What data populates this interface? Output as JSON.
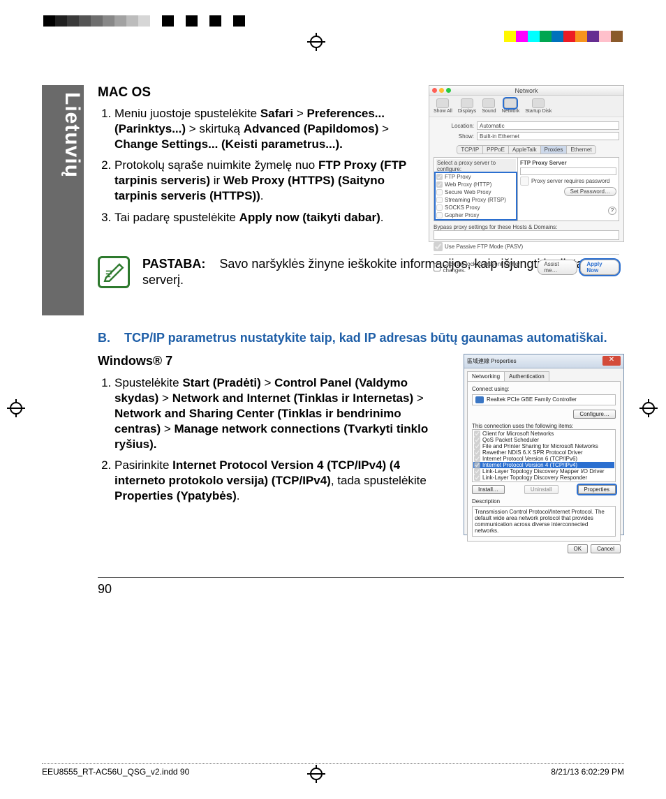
{
  "colorbar": {
    "left": [
      "#000000",
      "#202020",
      "#3a3a3a",
      "#545454",
      "#6e6e6e",
      "#888888",
      "#a2a2a2",
      "#bcbcbc",
      "#d6d6d6",
      "#ffffff",
      "#000000",
      "#ffffff",
      "#000000",
      "#ffffff",
      "#000000",
      "#ffffff",
      "#000000",
      "#ffffff"
    ],
    "right": [
      "#fff700",
      "#ff00ff",
      "#00ffff",
      "#00a651",
      "#0072bc",
      "#ed1c24",
      "#f7941d",
      "#662d91",
      "#ffc0cb",
      "#8b5a2b"
    ]
  },
  "langtab": "Lietuvių",
  "section1": {
    "title": "MAC OS",
    "items": [
      {
        "runs": [
          {
            "t": "Meniu juostoje spustelėkite "
          },
          {
            "t": "Safari",
            "b": true
          },
          {
            "t": " > "
          },
          {
            "t": "Preferences... (Parinktys...)",
            "b": true
          },
          {
            "t": " > skirtuką "
          },
          {
            "t": "Advanced (Papildomos)",
            "b": true
          },
          {
            "t": " > "
          },
          {
            "t": "Change Settings... (Keisti parametrus...).",
            "b": true
          }
        ]
      },
      {
        "runs": [
          {
            "t": "Protokolų sąraše nuimkite žymelę nuo "
          },
          {
            "t": "FTP Proxy (FTP tarpinis serveris)",
            "b": true
          },
          {
            "t": " ir "
          },
          {
            "t": "Web Proxy (HTTPS) (Saityno tarpinis serveris (HTTPS))",
            "b": true
          },
          {
            "t": "."
          }
        ]
      },
      {
        "runs": [
          {
            "t": "Tai padarę spustelėkite "
          },
          {
            "t": "Apply now (taikyti dabar)",
            "b": true
          },
          {
            "t": "."
          }
        ]
      }
    ],
    "mac": {
      "title": "Network",
      "toolbar": [
        "Show All",
        "Displays",
        "Sound",
        "Network",
        "Startup Disk"
      ],
      "loc_lbl": "Location:",
      "loc_val": "Automatic",
      "show_lbl": "Show:",
      "show_val": "Built-in Ethernet",
      "tabs": [
        "TCP/IP",
        "PPPoE",
        "AppleTalk",
        "Proxies",
        "Ethernet"
      ],
      "left_hd": "Select a proxy server to configure:",
      "protos": [
        {
          "label": "FTP Proxy",
          "chk": true
        },
        {
          "label": "Web Proxy (HTTP)",
          "chk": true
        },
        {
          "label": "Secure Web Proxy",
          "chk": false
        },
        {
          "label": "Streaming Proxy (RTSP)",
          "chk": false
        },
        {
          "label": "SOCKS Proxy",
          "chk": false
        },
        {
          "label": "Gopher Proxy",
          "chk": false
        }
      ],
      "right_title": "FTP Proxy Server",
      "pw_chk": "Proxy server requires password",
      "setpw": "Set Password…",
      "bypass_lbl": "Bypass proxy settings for these Hosts & Domains:",
      "pasv": "Use Passive FTP Mode (PASV)",
      "lock": "Click the lock to prevent further changes.",
      "assist": "Assist me…",
      "apply": "Apply Now"
    }
  },
  "note": {
    "label": "PASTABA:",
    "text": "Savo naršyklės žinyne ieškokite informacijos, kaip išjungti įgaliotąjį serverį."
  },
  "blue": {
    "prefix": "B.",
    "text": "TCP/IP parametrus nustatykite taip, kad IP adresas būtų gaunamas automatiškai."
  },
  "section2": {
    "title": "Windows® 7",
    "items": [
      {
        "runs": [
          {
            "t": "Spustelėkite "
          },
          {
            "t": "Start (Pradėti)",
            "b": true
          },
          {
            "t": " > "
          },
          {
            "t": "Control Panel (Valdymo skydas)",
            "b": true
          },
          {
            "t": " > "
          },
          {
            "t": "Network and Internet (Tinklas ir Internetas)",
            "b": true
          },
          {
            "t": " > "
          },
          {
            "t": "Network and Sharing Center (Tinklas ir bendrinimo centras)",
            "b": true
          },
          {
            "t": " > "
          },
          {
            "t": "Manage network connections (Tvarkyti tinklo ryšius).",
            "b": true
          }
        ]
      },
      {
        "runs": [
          {
            "t": "Pasirinkite "
          },
          {
            "t": "Internet Protocol Version 4 (TCP/IPv4) (4 interneto protokolo versija) (TCP/IPv4)",
            "b": true
          },
          {
            "t": ", tada spustelėkite "
          },
          {
            "t": "Properties (Ypatybės)",
            "b": true
          },
          {
            "t": "."
          }
        ]
      }
    ],
    "win": {
      "title": "區域連線 Properties",
      "tabs": [
        "Networking",
        "Authentication"
      ],
      "connect_lbl": "Connect using:",
      "adapter": "Realtek PCIe GBE Family Controller",
      "configure": "Configure…",
      "uses_lbl": "This connection uses the following items:",
      "items": [
        {
          "label": "Client for Microsoft Networks",
          "chk": true
        },
        {
          "label": "QoS Packet Scheduler",
          "chk": true
        },
        {
          "label": "File and Printer Sharing for Microsoft Networks",
          "chk": true
        },
        {
          "label": "Rawether NDIS 6.X SPR Protocol Driver",
          "chk": true
        },
        {
          "label": "Internet Protocol Version 6 (TCP/IPv6)",
          "chk": true
        },
        {
          "label": "Internet Protocol Version 4 (TCP/IPv4)",
          "chk": true,
          "sel": true
        },
        {
          "label": "Link-Layer Topology Discovery Mapper I/O Driver",
          "chk": true
        },
        {
          "label": "Link-Layer Topology Discovery Responder",
          "chk": true
        }
      ],
      "install": "Install…",
      "uninstall": "Uninstall",
      "properties": "Properties",
      "desc_lbl": "Description",
      "desc": "Transmission Control Protocol/Internet Protocol. The default wide area network protocol that provides communication across diverse interconnected networks.",
      "ok": "OK",
      "cancel": "Cancel"
    }
  },
  "page_number": "90",
  "footer": {
    "left": "EEU8555_RT-AC56U_QSG_v2.indd   90",
    "right": "8/21/13   6:02:29 PM"
  }
}
